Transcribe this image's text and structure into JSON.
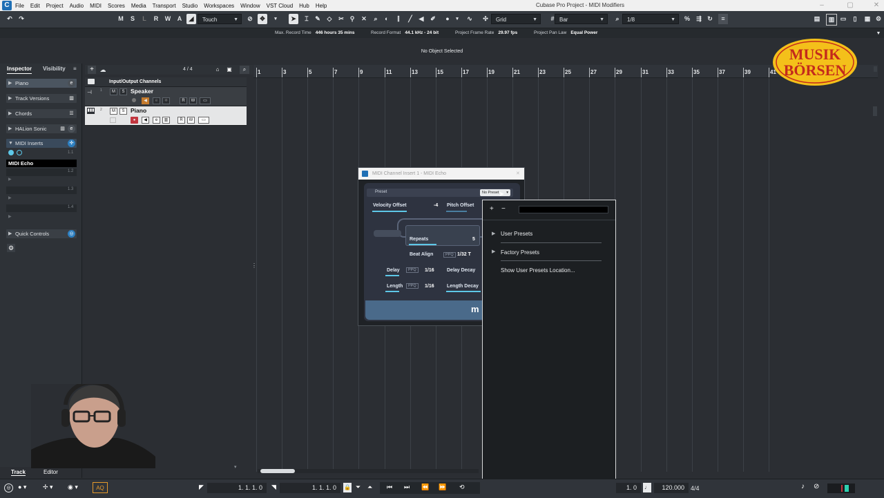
{
  "menubar": {
    "logo": "C",
    "items": [
      "File",
      "Edit",
      "Project",
      "Audio",
      "MIDI",
      "Scores",
      "Media",
      "Transport",
      "Studio",
      "Workspaces",
      "Window",
      "VST Cloud",
      "Hub",
      "Help"
    ],
    "title": "Cubase Pro Project - MIDI Modifiers"
  },
  "toolbar": {
    "msrwa": [
      "M",
      "S",
      "L",
      "R",
      "W",
      "A"
    ],
    "automation_mode": "Touch",
    "snap_type": "Grid",
    "grid_type": "Bar",
    "quantize": "1/8"
  },
  "infoline": {
    "max_record_label": "Max. Record Time",
    "max_record_value": "446 hours 35 mins",
    "record_format_label": "Record Format",
    "record_format_value": "44.1 kHz - 24 bit",
    "frame_rate_label": "Project Frame Rate",
    "frame_rate_value": "29.97 fps",
    "pan_law_label": "Project Pan Law",
    "pan_law_value": "Equal Power"
  },
  "status_message": "No Object Selected",
  "inspector": {
    "tabs": [
      "Inspector",
      "Visibility"
    ],
    "sections": [
      "Piano",
      "Track Versions",
      "Chords",
      "HALion Sonic",
      "MIDI Inserts",
      "Quick Controls"
    ],
    "insert_slots": [
      "MIDI Echo",
      "",
      "",
      ""
    ],
    "slot_badges": [
      "1.1",
      "1.2",
      "1.3",
      "1.4"
    ]
  },
  "tracklist": {
    "counter": "4 / 4",
    "folder": "Input/Output Channels",
    "tracks": [
      {
        "number": "1",
        "name": "Speaker"
      },
      {
        "number": "2",
        "name": "Piano"
      }
    ]
  },
  "ruler": {
    "bars": [
      "1",
      "3",
      "5",
      "7",
      "9",
      "11",
      "13",
      "15",
      "17",
      "19",
      "21",
      "23",
      "25",
      "27",
      "29",
      "31",
      "33",
      "35",
      "37",
      "39",
      "41"
    ]
  },
  "plugin": {
    "title": "MIDI Channel Insert 1 - MIDI Echo",
    "preset_label": "Preset",
    "preset_value": "No Preset",
    "velocity_offset_label": "Velocity Offset",
    "velocity_offset_value": "-4",
    "pitch_offset_label": "Pitch Offset",
    "repeats_label": "Repeats",
    "repeats_value": "5",
    "beat_align_label": "Beat Align",
    "beat_align_ppq": "PPQ",
    "beat_align_value": "1/32 T",
    "delay_label": "Delay",
    "delay_ppq": "PPQ",
    "delay_value": "1/16",
    "delay_decay_label": "Delay Decay",
    "length_label": "Length",
    "length_ppq": "PPQ",
    "length_value": "1/16",
    "length_decay_label": "Length Decay",
    "brand_mark": "m"
  },
  "preset_menu": {
    "items": [
      "User Presets",
      "Factory Presets",
      "Show User Presets Location..."
    ]
  },
  "lower_tabs": [
    "Track",
    "Editor"
  ],
  "transport": {
    "left_locator": "1. 1. 1.   0",
    "right_locator": "1. 1. 1.   0",
    "position_tail": "1.   0",
    "tempo": "120.000",
    "signature": "4/4",
    "aq": "AQ"
  },
  "logo_text": [
    "MUSIK",
    "BÖRSEN"
  ],
  "colors": {
    "accent": "#5ec8e8",
    "record": "#c2363f",
    "logo_yellow": "#f4c01a",
    "logo_red": "#c42a1c"
  }
}
